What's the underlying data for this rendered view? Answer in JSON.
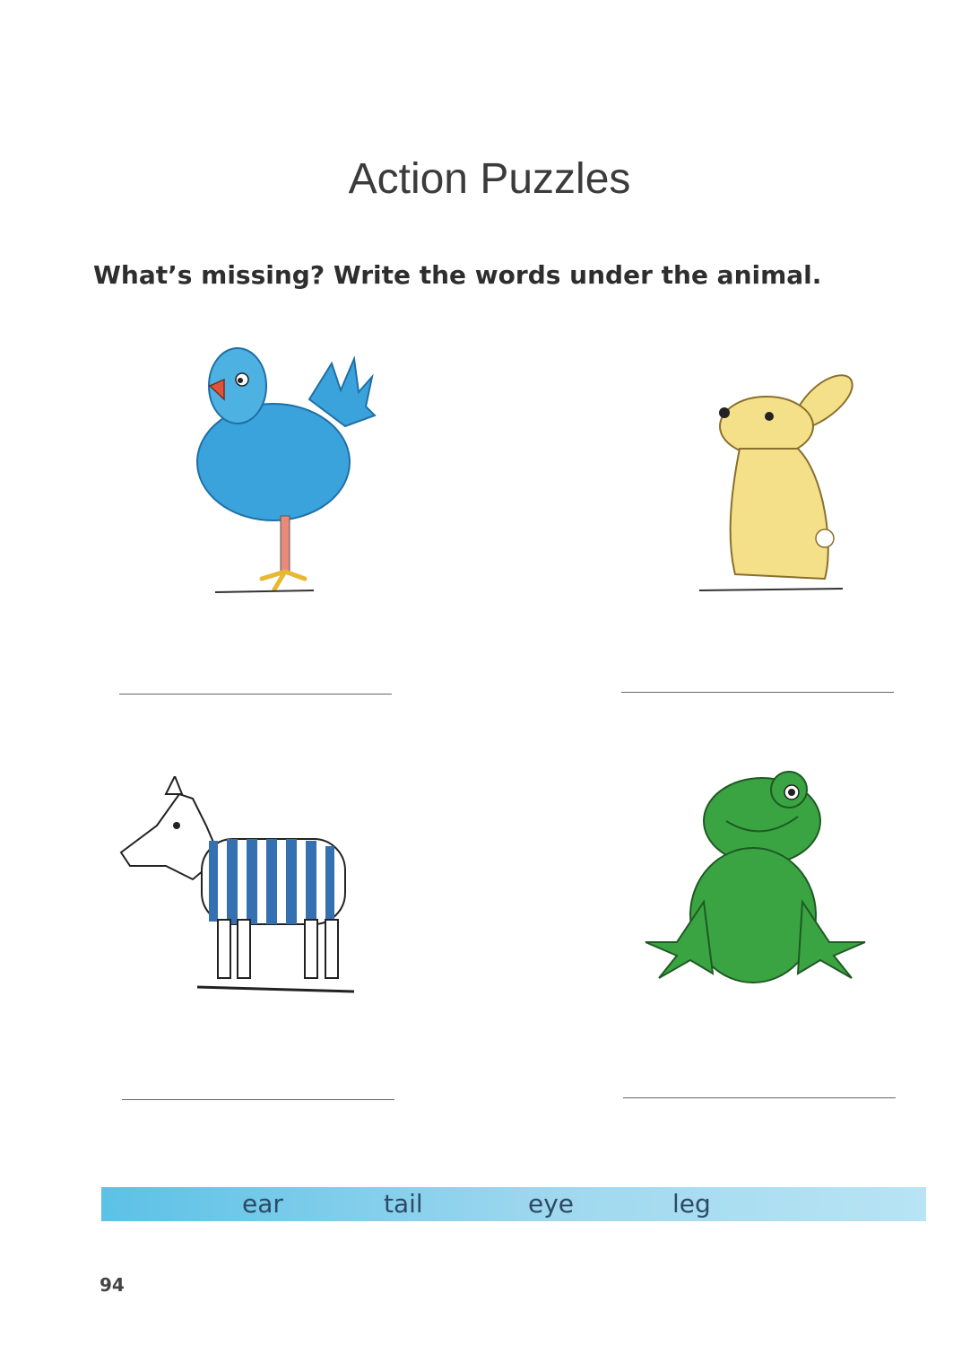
{
  "title": "Action Puzzles",
  "instruction": "What’s missing? Write the words under the animal.",
  "animals": [
    {
      "name": "bird-illustration",
      "color": "#3aa3dc"
    },
    {
      "name": "rabbit-illustration",
      "color": "#f5e08a"
    },
    {
      "name": "zebra-illustration",
      "color": "#3570b0"
    },
    {
      "name": "frog-illustration",
      "color": "#3aa443"
    }
  ],
  "answer_lines": [
    {
      "value": ""
    },
    {
      "value": ""
    },
    {
      "value": ""
    },
    {
      "value": ""
    }
  ],
  "word_bank": [
    "ear",
    "tail",
    "eye",
    "leg"
  ],
  "word_band_color": "#5cc1e6",
  "page_number": "94"
}
